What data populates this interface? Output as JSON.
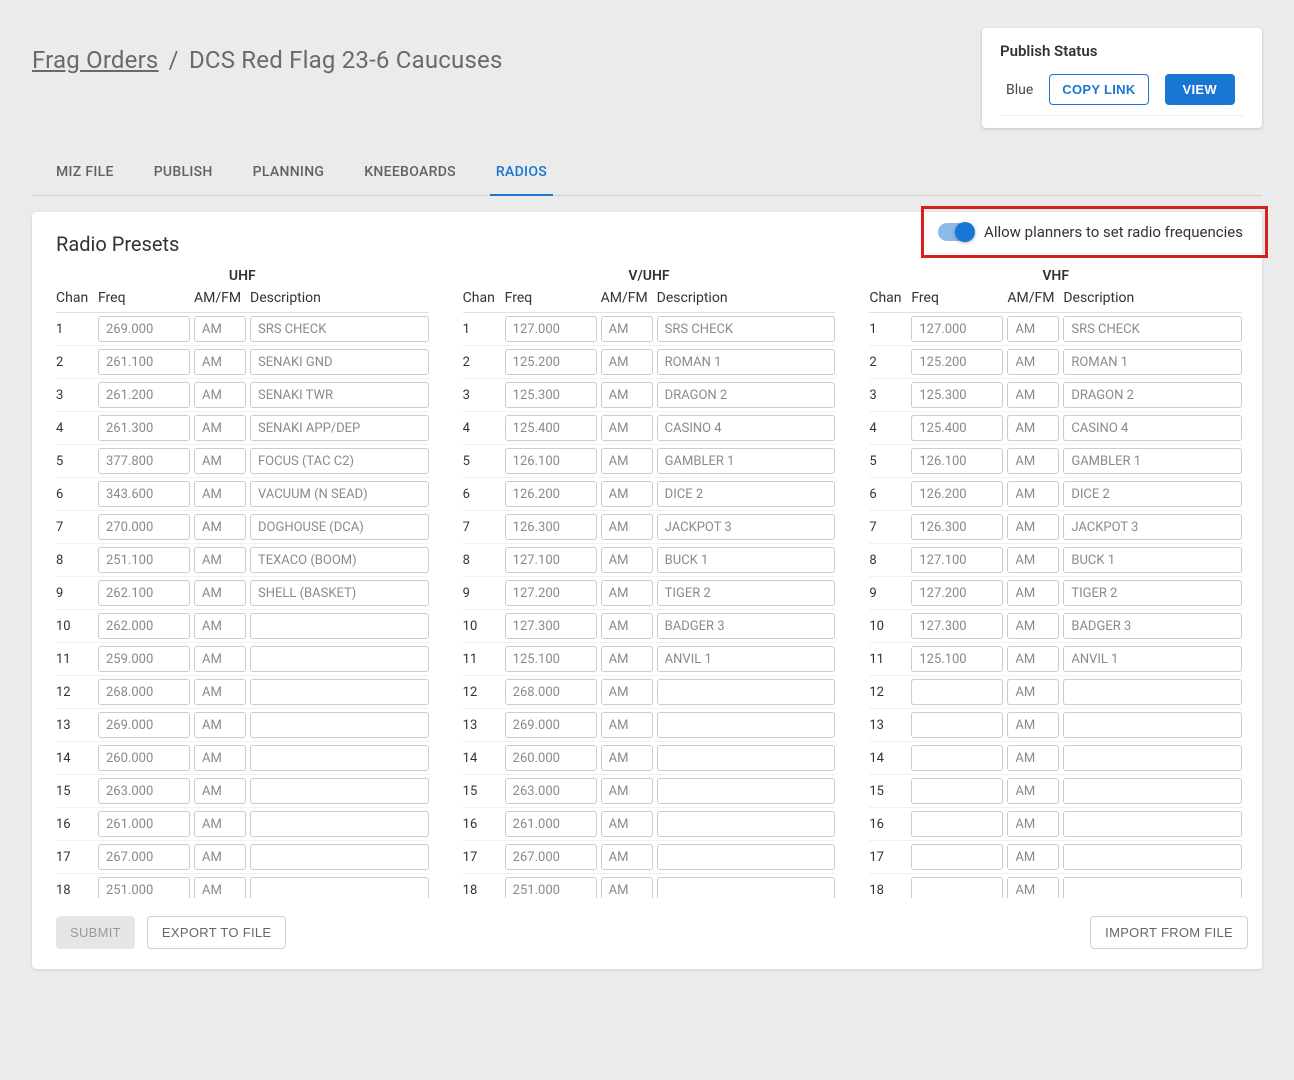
{
  "breadcrumb": {
    "root": "Frag Orders",
    "current": "DCS Red Flag 23-6 Caucuses"
  },
  "publish": {
    "title": "Publish Status",
    "coalition": "Blue",
    "copy_label": "COPY LINK",
    "view_label": "VIEW"
  },
  "tabs": [
    {
      "label": "MIZ FILE",
      "active": false
    },
    {
      "label": "PUBLISH",
      "active": false
    },
    {
      "label": "PLANNING",
      "active": false
    },
    {
      "label": "KNEEBOARDS",
      "active": false
    },
    {
      "label": "RADIOS",
      "active": true
    }
  ],
  "card": {
    "title": "Radio Presets",
    "toggle_label": "Allow planners to set radio frequencies"
  },
  "columns_header": {
    "chan": "Chan",
    "freq": "Freq",
    "amfm": "AM/FM",
    "desc": "Description"
  },
  "radios": [
    {
      "title": "UHF",
      "rows": [
        {
          "chan": "1",
          "freq": "269.000",
          "amfm": "AM",
          "desc": "SRS CHECK"
        },
        {
          "chan": "2",
          "freq": "261.100",
          "amfm": "AM",
          "desc": "SENAKI GND"
        },
        {
          "chan": "3",
          "freq": "261.200",
          "amfm": "AM",
          "desc": "SENAKI TWR"
        },
        {
          "chan": "4",
          "freq": "261.300",
          "amfm": "AM",
          "desc": "SENAKI APP/DEP"
        },
        {
          "chan": "5",
          "freq": "377.800",
          "amfm": "AM",
          "desc": "FOCUS (TAC C2)"
        },
        {
          "chan": "6",
          "freq": "343.600",
          "amfm": "AM",
          "desc": "VACUUM (N SEAD)"
        },
        {
          "chan": "7",
          "freq": "270.000",
          "amfm": "AM",
          "desc": "DOGHOUSE (DCA)"
        },
        {
          "chan": "8",
          "freq": "251.100",
          "amfm": "AM",
          "desc": "TEXACO (BOOM)"
        },
        {
          "chan": "9",
          "freq": "262.100",
          "amfm": "AM",
          "desc": "SHELL (BASKET)"
        },
        {
          "chan": "10",
          "freq": "262.000",
          "amfm": "AM",
          "desc": ""
        },
        {
          "chan": "11",
          "freq": "259.000",
          "amfm": "AM",
          "desc": ""
        },
        {
          "chan": "12",
          "freq": "268.000",
          "amfm": "AM",
          "desc": ""
        },
        {
          "chan": "13",
          "freq": "269.000",
          "amfm": "AM",
          "desc": ""
        },
        {
          "chan": "14",
          "freq": "260.000",
          "amfm": "AM",
          "desc": ""
        },
        {
          "chan": "15",
          "freq": "263.000",
          "amfm": "AM",
          "desc": ""
        },
        {
          "chan": "16",
          "freq": "261.000",
          "amfm": "AM",
          "desc": ""
        },
        {
          "chan": "17",
          "freq": "267.000",
          "amfm": "AM",
          "desc": ""
        },
        {
          "chan": "18",
          "freq": "251.000",
          "amfm": "AM",
          "desc": ""
        }
      ]
    },
    {
      "title": "V/UHF",
      "rows": [
        {
          "chan": "1",
          "freq": "127.000",
          "amfm": "AM",
          "desc": "SRS CHECK"
        },
        {
          "chan": "2",
          "freq": "125.200",
          "amfm": "AM",
          "desc": "ROMAN 1"
        },
        {
          "chan": "3",
          "freq": "125.300",
          "amfm": "AM",
          "desc": "DRAGON 2"
        },
        {
          "chan": "4",
          "freq": "125.400",
          "amfm": "AM",
          "desc": "CASINO 4"
        },
        {
          "chan": "5",
          "freq": "126.100",
          "amfm": "AM",
          "desc": "GAMBLER 1"
        },
        {
          "chan": "6",
          "freq": "126.200",
          "amfm": "AM",
          "desc": "DICE 2"
        },
        {
          "chan": "7",
          "freq": "126.300",
          "amfm": "AM",
          "desc": "JACKPOT 3"
        },
        {
          "chan": "8",
          "freq": "127.100",
          "amfm": "AM",
          "desc": "BUCK 1"
        },
        {
          "chan": "9",
          "freq": "127.200",
          "amfm": "AM",
          "desc": "TIGER 2"
        },
        {
          "chan": "10",
          "freq": "127.300",
          "amfm": "AM",
          "desc": "BADGER 3"
        },
        {
          "chan": "11",
          "freq": "125.100",
          "amfm": "AM",
          "desc": "ANVIL 1"
        },
        {
          "chan": "12",
          "freq": "268.000",
          "amfm": "AM",
          "desc": ""
        },
        {
          "chan": "13",
          "freq": "269.000",
          "amfm": "AM",
          "desc": ""
        },
        {
          "chan": "14",
          "freq": "260.000",
          "amfm": "AM",
          "desc": ""
        },
        {
          "chan": "15",
          "freq": "263.000",
          "amfm": "AM",
          "desc": ""
        },
        {
          "chan": "16",
          "freq": "261.000",
          "amfm": "AM",
          "desc": ""
        },
        {
          "chan": "17",
          "freq": "267.000",
          "amfm": "AM",
          "desc": ""
        },
        {
          "chan": "18",
          "freq": "251.000",
          "amfm": "AM",
          "desc": ""
        }
      ]
    },
    {
      "title": "VHF",
      "rows": [
        {
          "chan": "1",
          "freq": "127.000",
          "amfm": "AM",
          "desc": "SRS CHECK"
        },
        {
          "chan": "2",
          "freq": "125.200",
          "amfm": "AM",
          "desc": "ROMAN 1"
        },
        {
          "chan": "3",
          "freq": "125.300",
          "amfm": "AM",
          "desc": "DRAGON 2"
        },
        {
          "chan": "4",
          "freq": "125.400",
          "amfm": "AM",
          "desc": "CASINO 4"
        },
        {
          "chan": "5",
          "freq": "126.100",
          "amfm": "AM",
          "desc": "GAMBLER 1"
        },
        {
          "chan": "6",
          "freq": "126.200",
          "amfm": "AM",
          "desc": "DICE 2"
        },
        {
          "chan": "7",
          "freq": "126.300",
          "amfm": "AM",
          "desc": "JACKPOT 3"
        },
        {
          "chan": "8",
          "freq": "127.100",
          "amfm": "AM",
          "desc": "BUCK 1"
        },
        {
          "chan": "9",
          "freq": "127.200",
          "amfm": "AM",
          "desc": "TIGER 2"
        },
        {
          "chan": "10",
          "freq": "127.300",
          "amfm": "AM",
          "desc": "BADGER 3"
        },
        {
          "chan": "11",
          "freq": "125.100",
          "amfm": "AM",
          "desc": "ANVIL 1"
        },
        {
          "chan": "12",
          "freq": "",
          "amfm": "AM",
          "desc": ""
        },
        {
          "chan": "13",
          "freq": "",
          "amfm": "AM",
          "desc": ""
        },
        {
          "chan": "14",
          "freq": "",
          "amfm": "AM",
          "desc": ""
        },
        {
          "chan": "15",
          "freq": "",
          "amfm": "AM",
          "desc": ""
        },
        {
          "chan": "16",
          "freq": "",
          "amfm": "AM",
          "desc": ""
        },
        {
          "chan": "17",
          "freq": "",
          "amfm": "AM",
          "desc": ""
        },
        {
          "chan": "18",
          "freq": "",
          "amfm": "AM",
          "desc": ""
        }
      ]
    }
  ],
  "footer": {
    "submit": "SUBMIT",
    "export": "EXPORT TO FILE",
    "import": "IMPORT FROM FILE"
  }
}
